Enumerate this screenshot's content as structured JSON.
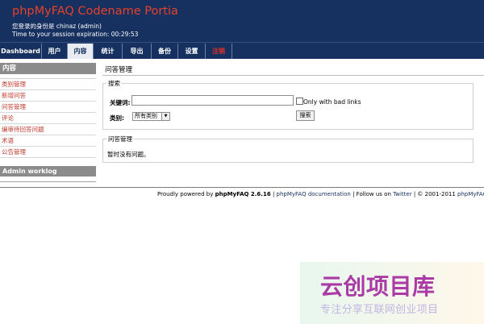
{
  "header": {
    "title": "phpMyFAQ Codename Portia",
    "login_label": "您登录的身份是",
    "login_user": "chinaz (admin)",
    "session_text": "Time to your session expiration: 00:29:53"
  },
  "nav": {
    "tabs": [
      {
        "label": "Dashboard"
      },
      {
        "label": "用户"
      },
      {
        "label": "内容"
      },
      {
        "label": "统计"
      },
      {
        "label": "导出"
      },
      {
        "label": "备份"
      },
      {
        "label": "设置"
      },
      {
        "label": "注销"
      }
    ]
  },
  "sidebar": {
    "header": "内容",
    "items": [
      {
        "label": "类别管理"
      },
      {
        "label": "新增问答"
      },
      {
        "label": "问答管理"
      },
      {
        "label": "评论"
      },
      {
        "label": "编审待回答问题"
      },
      {
        "label": "术语"
      },
      {
        "label": "公告管理"
      }
    ],
    "worklog": "Admin worklog"
  },
  "main": {
    "title": "问答管理",
    "search": {
      "legend": "搜索",
      "keyword_label": "关键词:",
      "keyword_value": "",
      "bad_links_label": "Only with bad links",
      "category_label": "类别:",
      "category_selected": "所有类别",
      "button_label": "搜索"
    },
    "results": {
      "legend": "问答管理",
      "empty_text": "暂时没有问题。"
    }
  },
  "footer": {
    "powered": "Proudly powered by",
    "product": "phpMyFAQ 2.6.16",
    "sep1": "|",
    "docs": "phpMyFAQ documentation",
    "sep2": "|",
    "follow": "Follow us on",
    "twitter": "Twitter",
    "sep3": "|",
    "copyright": "© 2001-2011",
    "team": "phpMyFAQ Team"
  },
  "watermark": {
    "big": "云创项目库",
    "small": "专注分享互联网创业项目"
  }
}
